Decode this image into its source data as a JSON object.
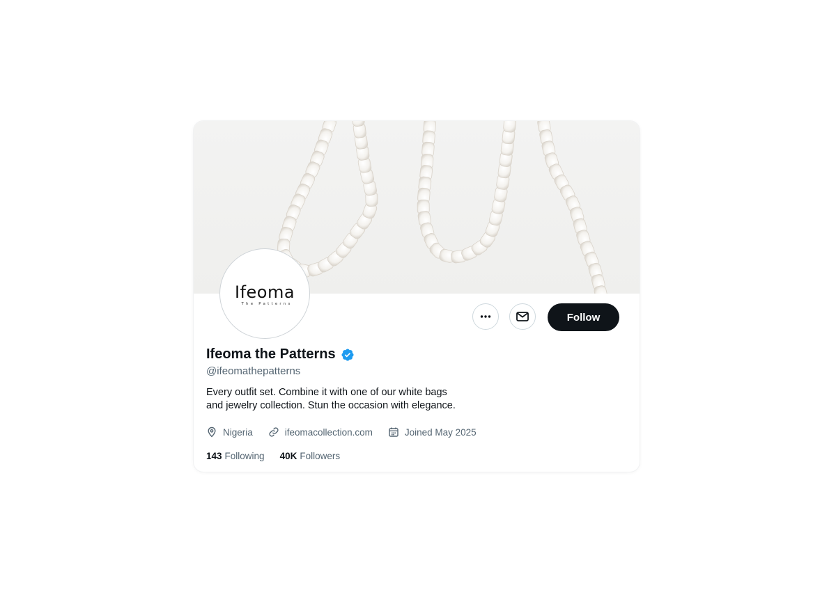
{
  "profile": {
    "display_name": "Ifeoma the Patterns",
    "handle": "@ifeomathepatterns",
    "verified": true,
    "bio": "Every outfit set.  Combine it with one of our white bags\nand jewelry collection.  Stun the occasion with elegance.",
    "avatar": {
      "wordmark": "Ifeoma",
      "subtitle": "The Patterns"
    },
    "location": "Nigeria",
    "website": "ifeomacollection.com",
    "joined": "Joined May 2025",
    "following_count": "143",
    "following_label": "Following",
    "followers_count": "40K",
    "followers_label": "Followers"
  },
  "actions": {
    "follow_label": "Follow",
    "more_icon": "more-horizontal-icon",
    "message_icon": "mail-icon"
  },
  "icons": {
    "verified": "verified-badge-icon",
    "location": "location-pin-icon",
    "link": "link-icon",
    "calendar": "calendar-icon"
  },
  "colors": {
    "text_primary": "#0f1419",
    "text_secondary": "#536471",
    "verified_blue": "#1d9bf0",
    "follow_button_bg": "#0f1419",
    "border": "#cfd9de"
  }
}
